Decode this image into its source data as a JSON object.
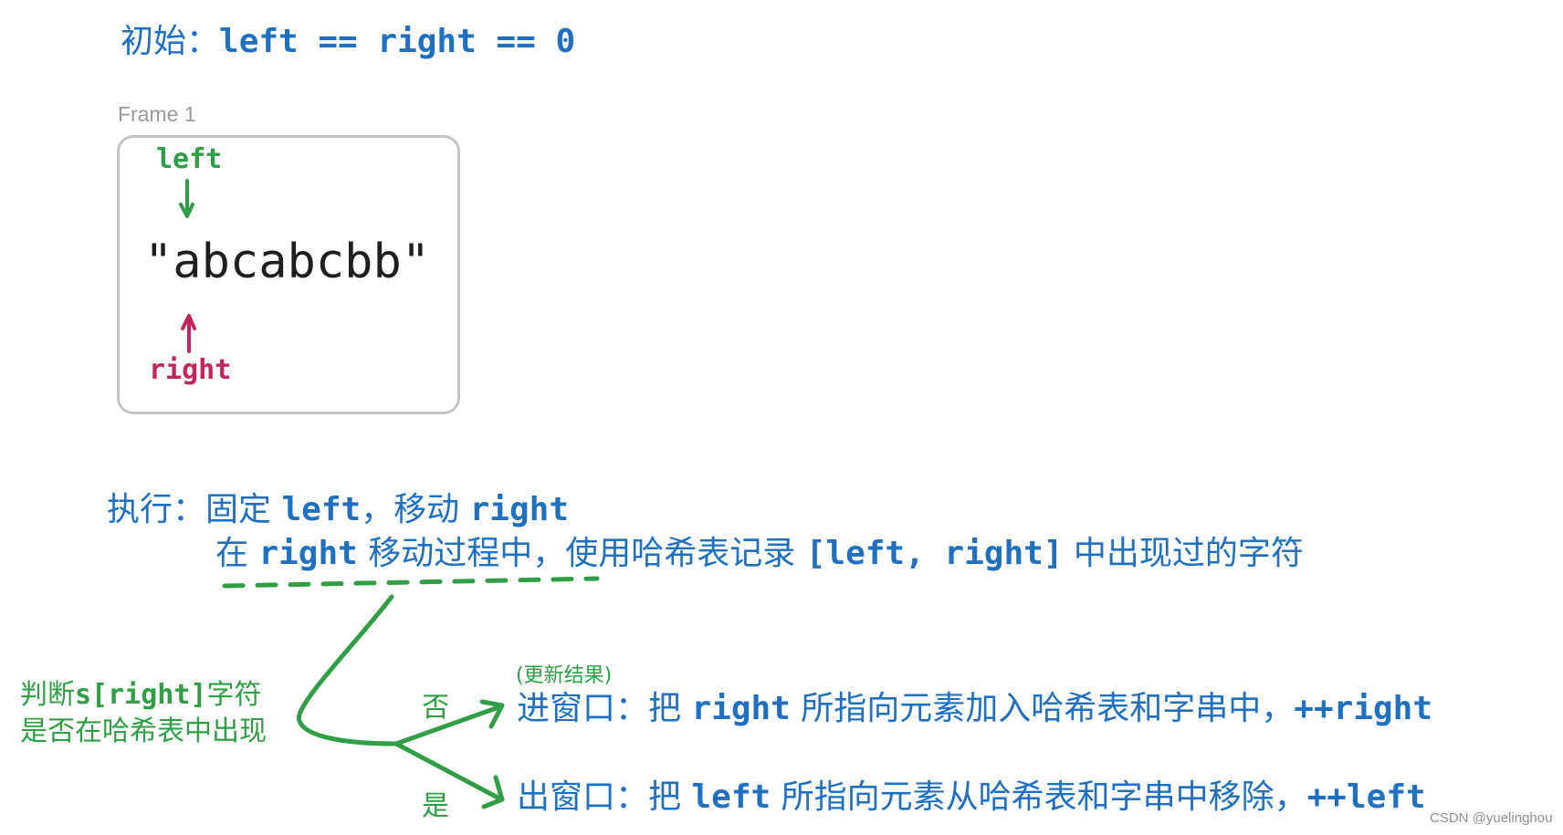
{
  "title": {
    "label": "初始：",
    "code": "left == right == 0"
  },
  "frame": {
    "label": "Frame 1",
    "left_pointer": "left",
    "string_value": "\"abcabcbb\"",
    "right_pointer": "right"
  },
  "execute": {
    "line1_label": "执行：",
    "line1_a": "固定 ",
    "line1_code_a": "left",
    "line1_b": "，移动 ",
    "line1_code_b": "right",
    "line2_a": "在 ",
    "line2_code_a": "right",
    "line2_b": " 移动过程中，使用哈希表记录 ",
    "line2_code_b": "[left, right]",
    "line2_c": " 中出现过的字符"
  },
  "decision": {
    "line1_a": "判断",
    "line1_code": "s[right]",
    "line1_b": "字符",
    "line2": "是否在哈希表中出现",
    "branch_no": "否",
    "branch_yes": "是",
    "update_note": "(更新结果)"
  },
  "enter_window": {
    "label": "进窗口：",
    "a": "把 ",
    "code_a": "right",
    "b": " 所指向元素加入哈希表和字串中，",
    "code_b": "++right"
  },
  "exit_window": {
    "label": "出窗口：",
    "a": "把 ",
    "code_a": "left",
    "b": " 所指向元素从哈希表和字串中移除，",
    "code_b": "++left"
  },
  "watermark": "CSDN @yuelinghou",
  "colors": {
    "text_blue": "#1f70c1",
    "pointer_green": "#2f9e44",
    "pointer_crimson": "#c2255c",
    "frame_border": "#c4c4c4"
  }
}
